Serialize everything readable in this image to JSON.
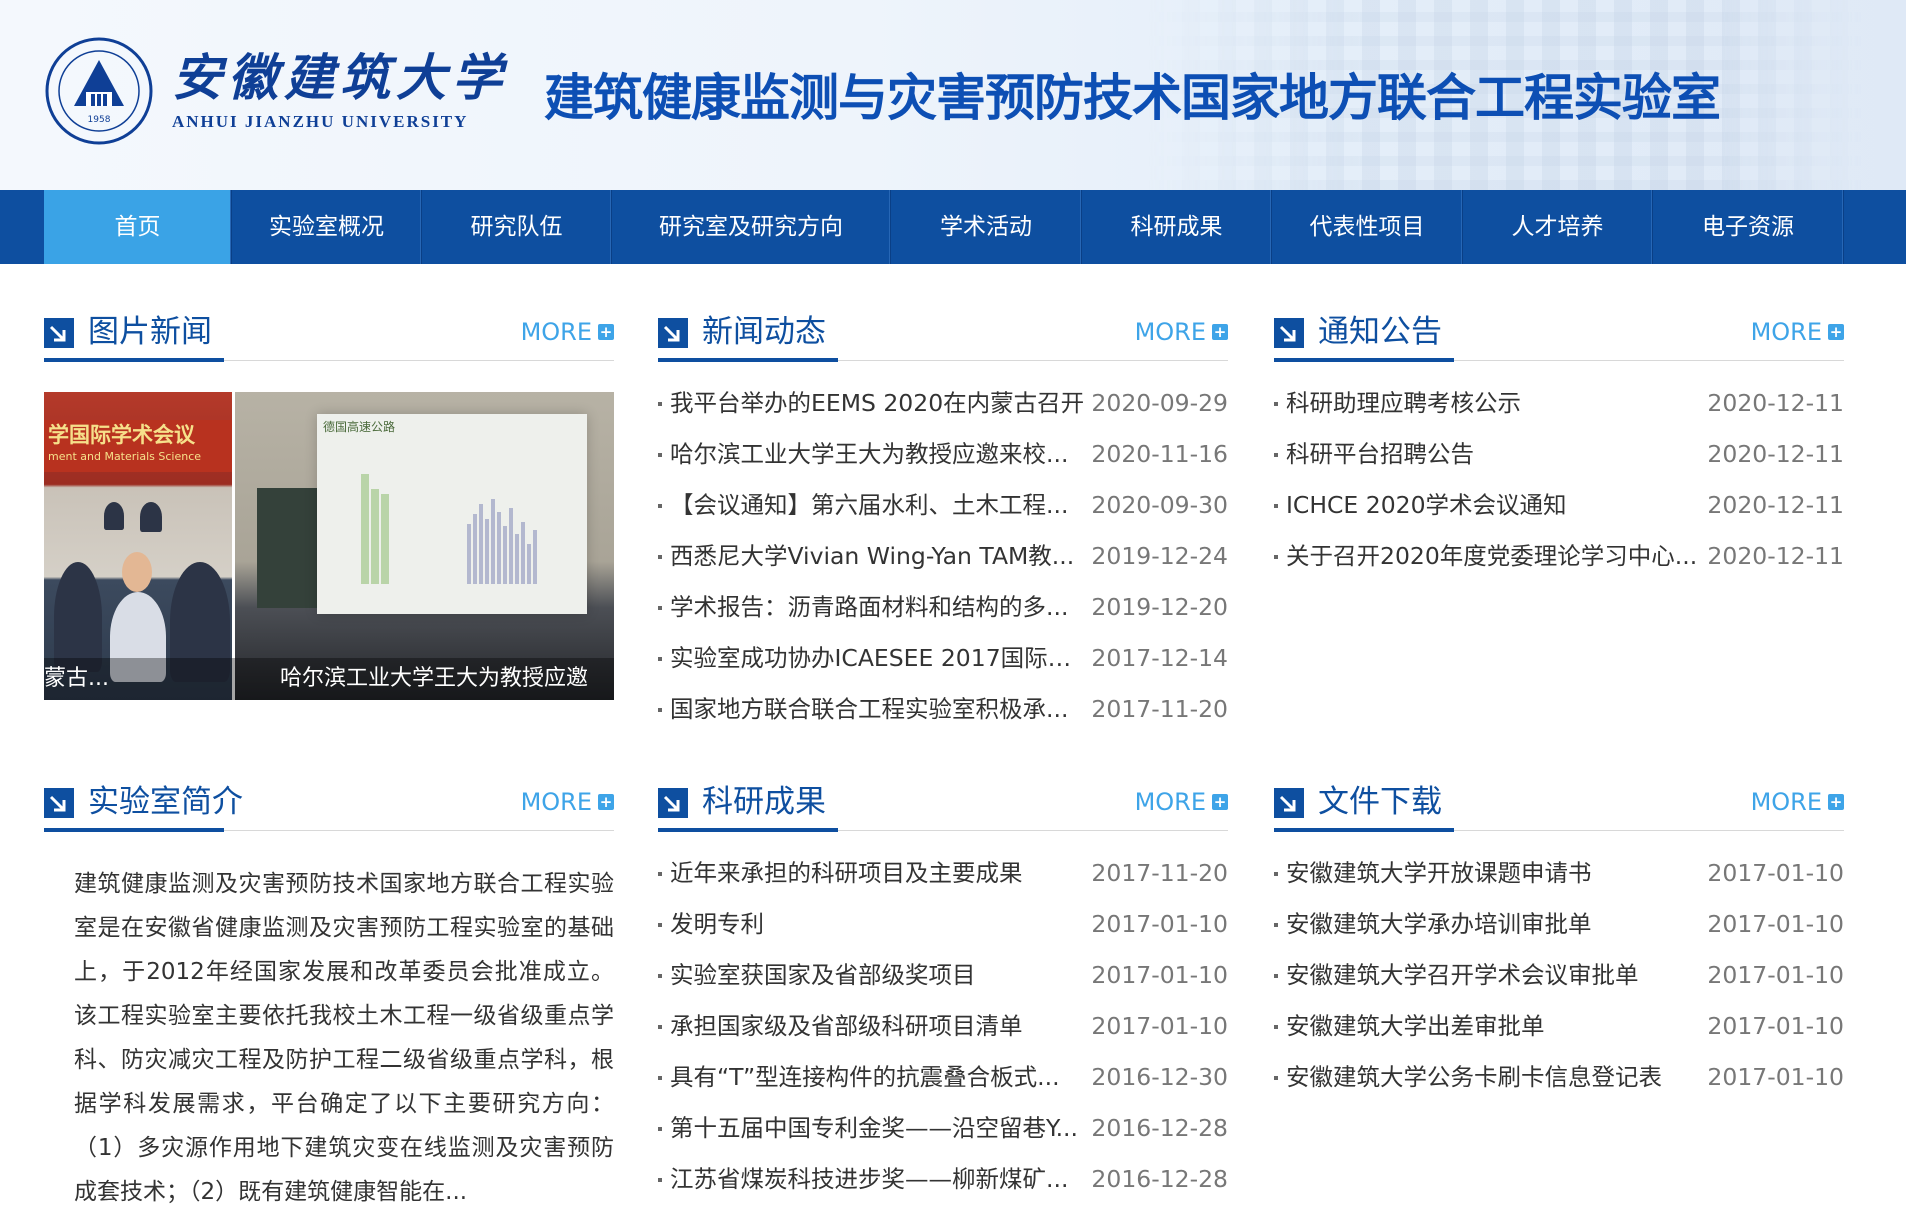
{
  "header": {
    "university_cn": "安徽建筑大学",
    "university_en": "ANHUI JIANZHU UNIVERSITY",
    "seal_year": "1958",
    "lab_title": "建筑健康监测与灾害预防技术国家地方联合工程实验室"
  },
  "nav": {
    "items": [
      {
        "label": "首页",
        "active": true
      },
      {
        "label": "实验室概况"
      },
      {
        "label": "研究队伍"
      },
      {
        "label": "研究室及研究方向"
      },
      {
        "label": "学术活动"
      },
      {
        "label": "科研成果"
      },
      {
        "label": "代表性项目"
      },
      {
        "label": "人才培养"
      },
      {
        "label": "电子资源"
      }
    ]
  },
  "more_label": "MORE",
  "sections": {
    "photo_news": {
      "title": "图片新闻",
      "photo1_banner": "学国际学术会议",
      "photo1_banner_en": "ment and Materials Science",
      "photo1_caption": "蒙古...",
      "photo2_screen_caption": "德国高速公路",
      "photo2_caption": "哈尔滨工业大学王大为教授应邀"
    },
    "news": {
      "title": "新闻动态",
      "items": [
        {
          "title": "我平台举办的EEMS 2020在内蒙古召开",
          "date": "2020-09-29"
        },
        {
          "title": "哈尔滨工业大学王大为教授应邀来校...",
          "date": "2020-11-16"
        },
        {
          "title": "【会议通知】第六届水利、土木工程...",
          "date": "2020-09-30"
        },
        {
          "title": "西悉尼大学Vivian Wing-Yan TAM教...",
          "date": "2019-12-24"
        },
        {
          "title": "学术报告：沥青路面材料和结构的多...",
          "date": "2019-12-20"
        },
        {
          "title": "实验室成功协办ICAESEE 2017国际学...",
          "date": "2017-12-14"
        },
        {
          "title": "国家地方联合联合工程实验室积极承...",
          "date": "2017-11-20"
        }
      ]
    },
    "notices": {
      "title": "通知公告",
      "items": [
        {
          "title": "科研助理应聘考核公示",
          "date": "2020-12-11"
        },
        {
          "title": "科研平台招聘公告",
          "date": "2020-12-11"
        },
        {
          "title": "ICHCE 2020学术会议通知",
          "date": "2020-12-11"
        },
        {
          "title": "关于召开2020年度党委理论学习中心...",
          "date": "2020-12-11"
        }
      ]
    },
    "intro": {
      "title": "实验室简介",
      "text": "建筑健康监测及灾害预防技术国家地方联合工程实验室是在安徽省健康监测及灾害预防工程实验室的基础上，于2012年经国家发展和改革委员会批准成立。该工程实验室主要依托我校土木工程一级省级重点学科、防灾减灾工程及防护工程二级省级重点学科，根据学科发展需求，平台确定了以下主要研究方向：（1）多灾源作用地下建筑灾变在线监测及灾害预防成套技术；（2）既有建筑健康智能在..."
    },
    "research": {
      "title": "科研成果",
      "items": [
        {
          "title": "近年来承担的科研项目及主要成果",
          "date": "2017-11-20"
        },
        {
          "title": "发明专利",
          "date": "2017-01-10"
        },
        {
          "title": "实验室获国家及省部级奖项目",
          "date": "2017-01-10"
        },
        {
          "title": "承担国家级及省部级科研项目清单",
          "date": "2017-01-10"
        },
        {
          "title": "具有“T”型连接构件的抗震叠合板式...",
          "date": "2016-12-30"
        },
        {
          "title": "第十五届中国专利金奖——沿空留巷Y...",
          "date": "2016-12-28"
        },
        {
          "title": "江苏省煤炭科技进步奖——柳新煤矿...",
          "date": "2016-12-28"
        }
      ]
    },
    "downloads": {
      "title": "文件下载",
      "items": [
        {
          "title": "安徽建筑大学开放课题申请书",
          "date": "2017-01-10"
        },
        {
          "title": "安徽建筑大学承办培训审批单",
          "date": "2017-01-10"
        },
        {
          "title": "安徽建筑大学召开学术会议审批单",
          "date": "2017-01-10"
        },
        {
          "title": "安徽建筑大学出差审批单",
          "date": "2017-01-10"
        },
        {
          "title": "安徽建筑大学公务卡刷卡信息登记表",
          "date": "2017-01-10"
        }
      ]
    }
  },
  "colors": {
    "brand_blue": "#0e4fa0",
    "nav_active": "#3aa3e6",
    "more_blue": "#3ea4e8",
    "title_blue": "#0d4fb4"
  }
}
